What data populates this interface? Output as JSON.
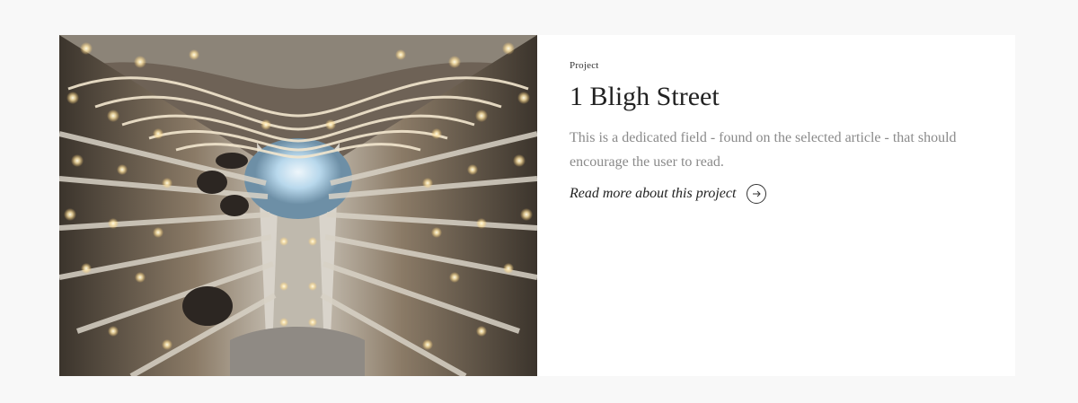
{
  "card": {
    "image": {
      "alt": "1 Bligh Street atrium",
      "icon": "atrium-photo"
    },
    "category": "Project",
    "title": "1 Bligh Street",
    "description": "This is a dedicated field - found on the selected article - that should encourage the user to read.",
    "link": {
      "label": "Read more about this project",
      "icon": "arrow-right-circle-icon"
    }
  },
  "colors": {
    "page_background": "#f8f8f8",
    "card_background": "#ffffff",
    "title": "#222222",
    "description": "#8a8a8a"
  }
}
